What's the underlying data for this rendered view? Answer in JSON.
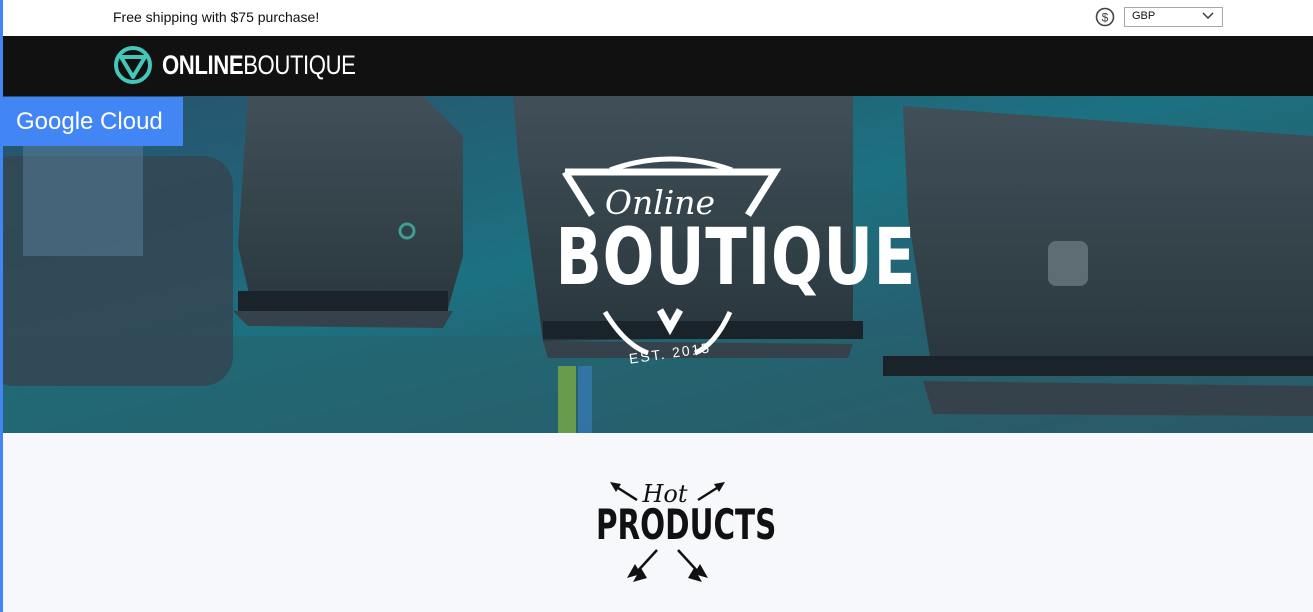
{
  "topbar": {
    "shipping_text": "Free shipping with $75 purchase!",
    "currency_icon": "dollar-circle-icon",
    "currency_value": "GBP"
  },
  "navbar": {
    "logo_bold": "ONLINE",
    "logo_light": "BOUTIQUE",
    "logo_icon": "triangle-circle-logo-icon",
    "bg_color": "#111111",
    "accent_color": "#44c6b8"
  },
  "badge": {
    "label": "Google Cloud",
    "color": "#4285f4"
  },
  "hero": {
    "script_text": "Online",
    "main_text": "BOUTIQUE",
    "est_text": "EST. 2015"
  },
  "hot_products": {
    "script_text": "Hot",
    "main_text": "PRODUCTS"
  }
}
